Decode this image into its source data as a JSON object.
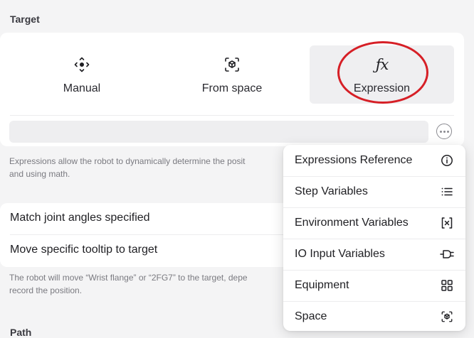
{
  "target": {
    "section_label": "Target",
    "modes": [
      {
        "label": "Manual",
        "icon": "move-arrows-icon"
      },
      {
        "label": "From space",
        "icon": "cube-scan-icon"
      },
      {
        "label": "Expression",
        "icon": "fx-icon",
        "icon_glyph": "ƒx",
        "selected": true
      }
    ],
    "expression_input": {
      "value": "",
      "placeholder": ""
    },
    "helper_text": "Expressions allow the robot to dynamically determine the posit\nand using math."
  },
  "options": [
    {
      "label": "Match joint angles specified"
    },
    {
      "label": "Move specific tooltip to target"
    }
  ],
  "tooltip_helper_text": "The robot will move “Wrist flange” or “2FG7” to the target, depe\nrecord the position.",
  "path": {
    "section_label": "Path"
  },
  "menu": {
    "items": [
      {
        "label": "Expressions Reference",
        "icon": "info-circle-icon"
      },
      {
        "label": "Step Variables",
        "icon": "list-icon"
      },
      {
        "label": "Environment Variables",
        "icon": "bracket-x-icon"
      },
      {
        "label": "IO Input Variables",
        "icon": "plug-icon"
      },
      {
        "label": "Equipment",
        "icon": "grid-icon"
      },
      {
        "label": "Space",
        "icon": "cube-scan-icon"
      }
    ]
  },
  "colors": {
    "highlight_ring": "#d61f26",
    "selected_mode_bg": "#efeff1",
    "background": "#f4f4f5"
  }
}
